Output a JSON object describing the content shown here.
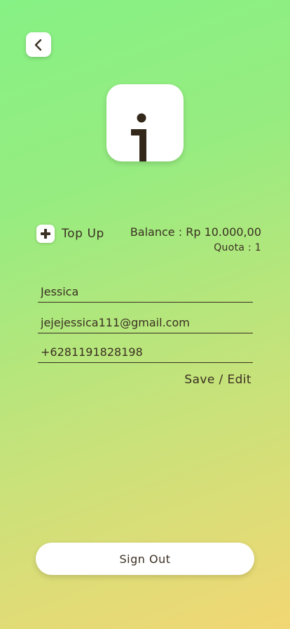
{
  "header": {
    "back_icon": "chevron-left-icon"
  },
  "profile": {
    "avatar_icon": "info-icon"
  },
  "wallet": {
    "topup_icon": "plus-icon",
    "topup_label": "Top Up",
    "balance_text": "Balance : Rp 10.000,00",
    "quota_text": "Quota : 1"
  },
  "form": {
    "name_value": "Jessica",
    "email_value": "jejejessica111@gmail.com",
    "phone_value": "+6281191828198",
    "save_label": "Save / Edit"
  },
  "footer": {
    "signout_label": "Sign Out"
  },
  "colors": {
    "gradient_top": "#86f184",
    "gradient_bottom": "#f2d774",
    "text": "#3b2f22",
    "card": "#ffffff"
  }
}
